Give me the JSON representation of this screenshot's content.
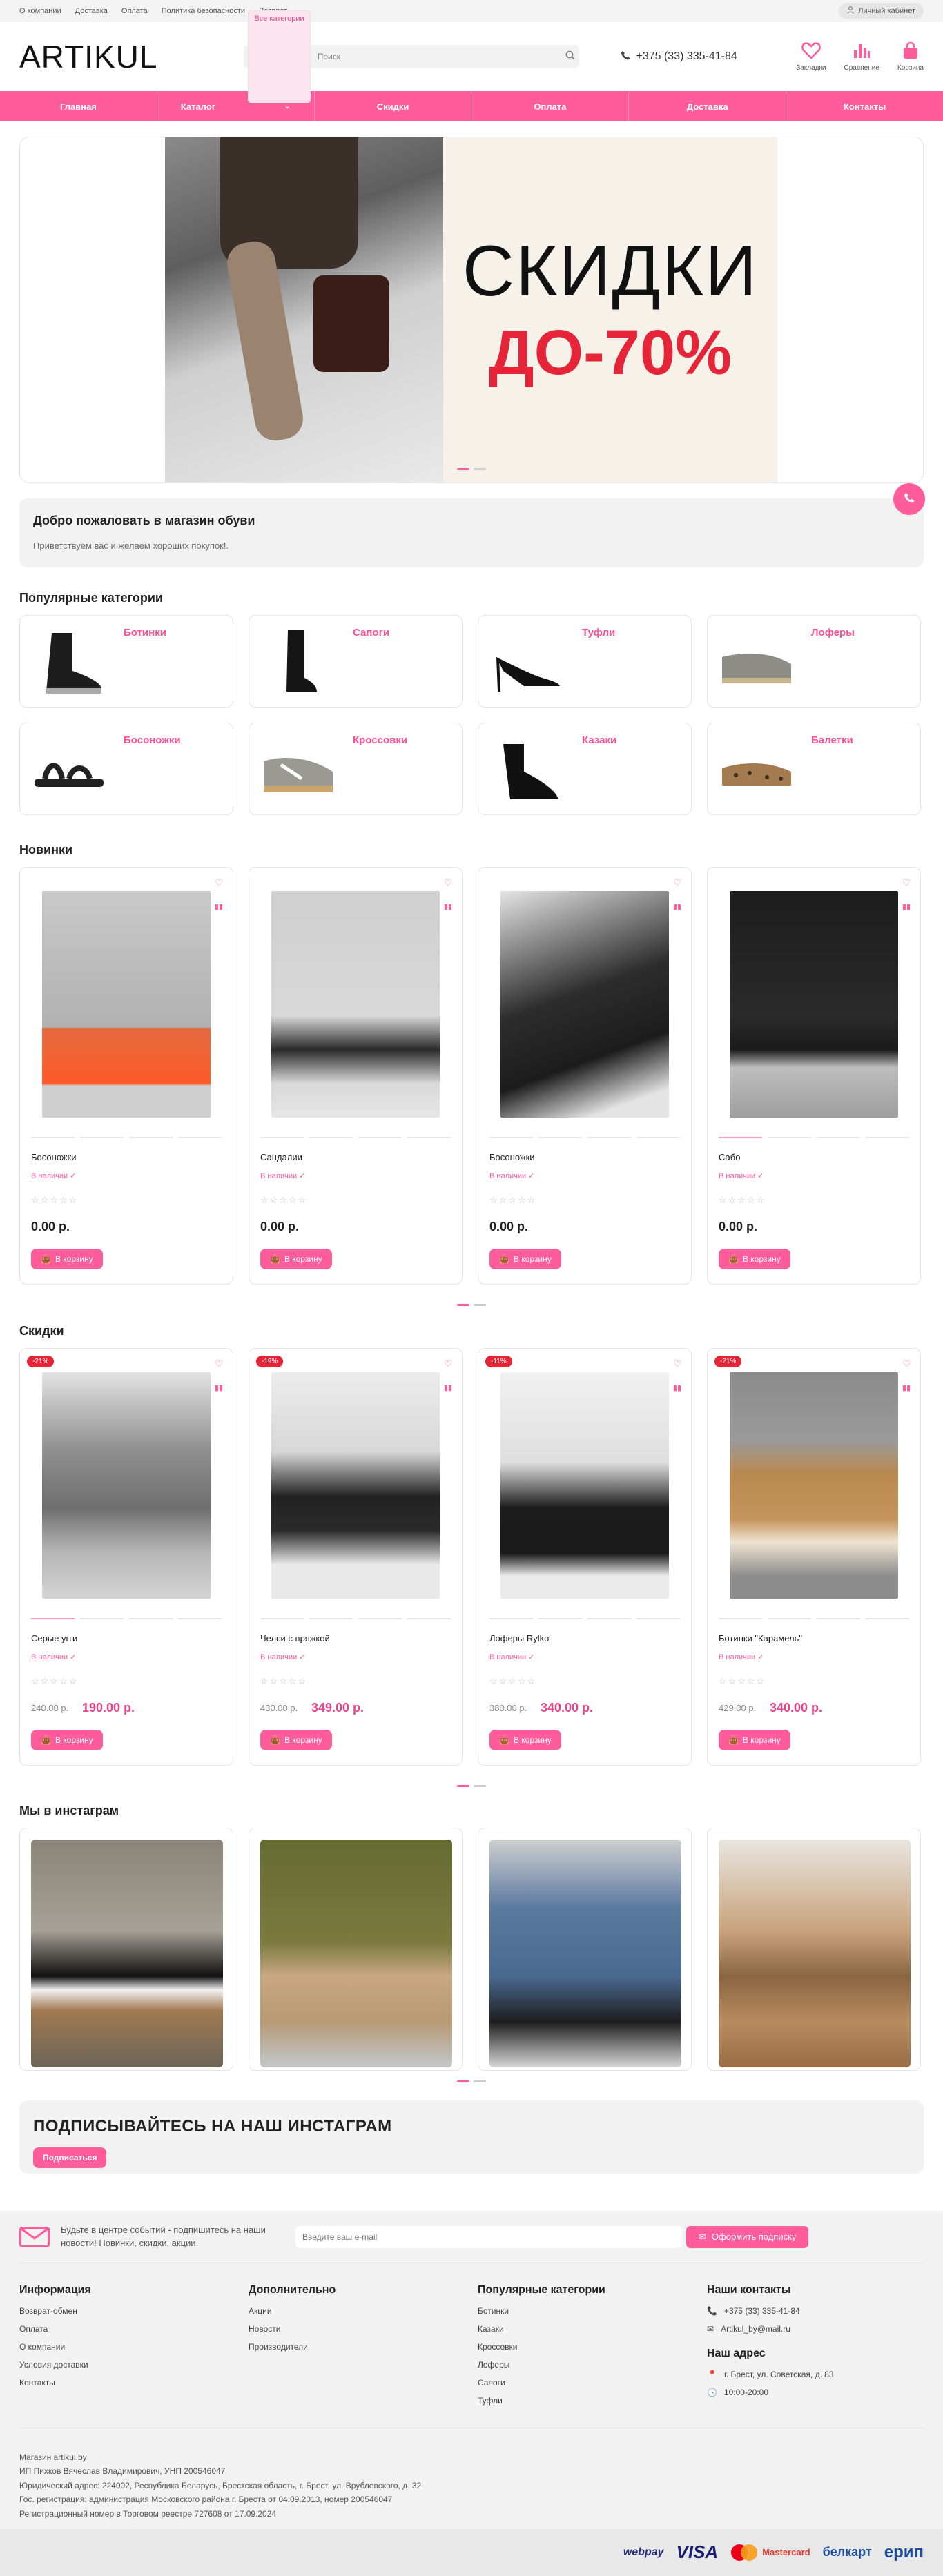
{
  "topbar": {
    "links": [
      "О компании",
      "Доставка",
      "Оплата",
      "Политика безопасности",
      "Возврат"
    ],
    "account": "Личный кабинет"
  },
  "header": {
    "logo": "ARTIKUL",
    "search_category": "Все категории",
    "search_placeholder": "Поиск",
    "phone": "+375 (33) 335-41-84",
    "icons": [
      {
        "label": "Закладки",
        "icon": "heart-icon"
      },
      {
        "label": "Сравнение",
        "icon": "compare-icon"
      },
      {
        "label": "Корзина",
        "icon": "bag-icon"
      }
    ]
  },
  "nav": [
    "Главная",
    "Каталог",
    "Скидки",
    "Оплата",
    "Доставка",
    "Контакты"
  ],
  "hero": {
    "line1": "СКИДКИ",
    "line2": "ДО-70%"
  },
  "welcome": {
    "title": "Добро пожаловать в магазин обуви",
    "text": "Приветствуем вас и желаем хороших покупок!."
  },
  "categories": {
    "title": "Популярные категории",
    "items": [
      "Ботинки",
      "Сапоги",
      "Туфли",
      "Лоферы",
      "Босоножки",
      "Кроссовки",
      "Казаки",
      "Балетки"
    ]
  },
  "new_items": {
    "title": "Новинки",
    "items": [
      {
        "name": "Босоножки",
        "stock": "В наличии ✓",
        "price": "0.00 р.",
        "cart": "В корзину"
      },
      {
        "name": "Сандалии",
        "stock": "В наличии ✓",
        "price": "0.00 р.",
        "cart": "В корзину"
      },
      {
        "name": "Босоножки",
        "stock": "В наличии ✓",
        "price": "0.00 р.",
        "cart": "В корзину"
      },
      {
        "name": "Сабо",
        "stock": "В наличии ✓",
        "price": "0.00 р.",
        "cart": "В корзину"
      }
    ]
  },
  "sale_items": {
    "title": "Скидки",
    "items": [
      {
        "badge": "-21%",
        "name": "Серые угги",
        "stock": "В наличии ✓",
        "old_price": "240.00 р.",
        "price": "190.00 р.",
        "cart": "В корзину"
      },
      {
        "badge": "-19%",
        "name": "Челси с пряжкой",
        "stock": "В наличии ✓",
        "old_price": "430.00 р.",
        "price": "349.00 р.",
        "cart": "В корзину"
      },
      {
        "badge": "-11%",
        "name": "Лоферы Rylko",
        "stock": "В наличии ✓",
        "old_price": "380.00 р.",
        "price": "340.00 р.",
        "cart": "В корзину"
      },
      {
        "badge": "-21%",
        "name": "Ботинки \"Карамель\"",
        "stock": "В наличии ✓",
        "old_price": "429.00 р.",
        "price": "340.00 р.",
        "cart": "В корзину"
      }
    ]
  },
  "instagram": {
    "title": "Мы в инстаграм"
  },
  "subscribe": {
    "title": "ПОДПИСЫВАЙТЕСЬ НА НАШ ИНСТАГРАМ",
    "button": "Подписаться"
  },
  "footer": {
    "newsletter_text": "Будьте в центре событий - подпишитесь на наши новости! Новинки, скидки, акции.",
    "email_placeholder": "Введите ваш e-mail",
    "subscribe_button": "Оформить подписку",
    "col1": {
      "title": "Информация",
      "links": [
        "Возврат-обмен",
        "Оплата",
        "О компании",
        "Условия доставки",
        "Контакты"
      ]
    },
    "col2": {
      "title": "Дополнительно",
      "links": [
        "Акции",
        "Новости",
        "Производители"
      ]
    },
    "col3": {
      "title": "Популярные категории",
      "links": [
        "Ботинки",
        "Казаки",
        "Кроссовки",
        "Лоферы",
        "Сапоги",
        "Туфли"
      ]
    },
    "col4": {
      "title": "Наши контакты",
      "phone": "+375 (33) 335-41-84",
      "email": "Artikul_by@mail.ru",
      "address_title": "Наш адрес",
      "address": "г. Брест, ул. Советская, д. 83",
      "hours": "10:00-20:00"
    },
    "legal": [
      "Магазин artikul.by",
      "ИП Пихков Вячеслав Владимирович, УНП 200546047",
      "Юридический адрес: 224002, Республика Беларусь, Брестская область, г. Брест, ул. Врублевского, д. 32",
      "Гос. регистрация: администрация Московского района г. Бреста от 04.09.2013, номер 200546047",
      "Регистрационный номер в Торговом реестре 727608 от 17.09.2024"
    ],
    "payments": [
      "webpay",
      "VISA",
      "Mastercard",
      "белкарт",
      "ерип"
    ]
  }
}
